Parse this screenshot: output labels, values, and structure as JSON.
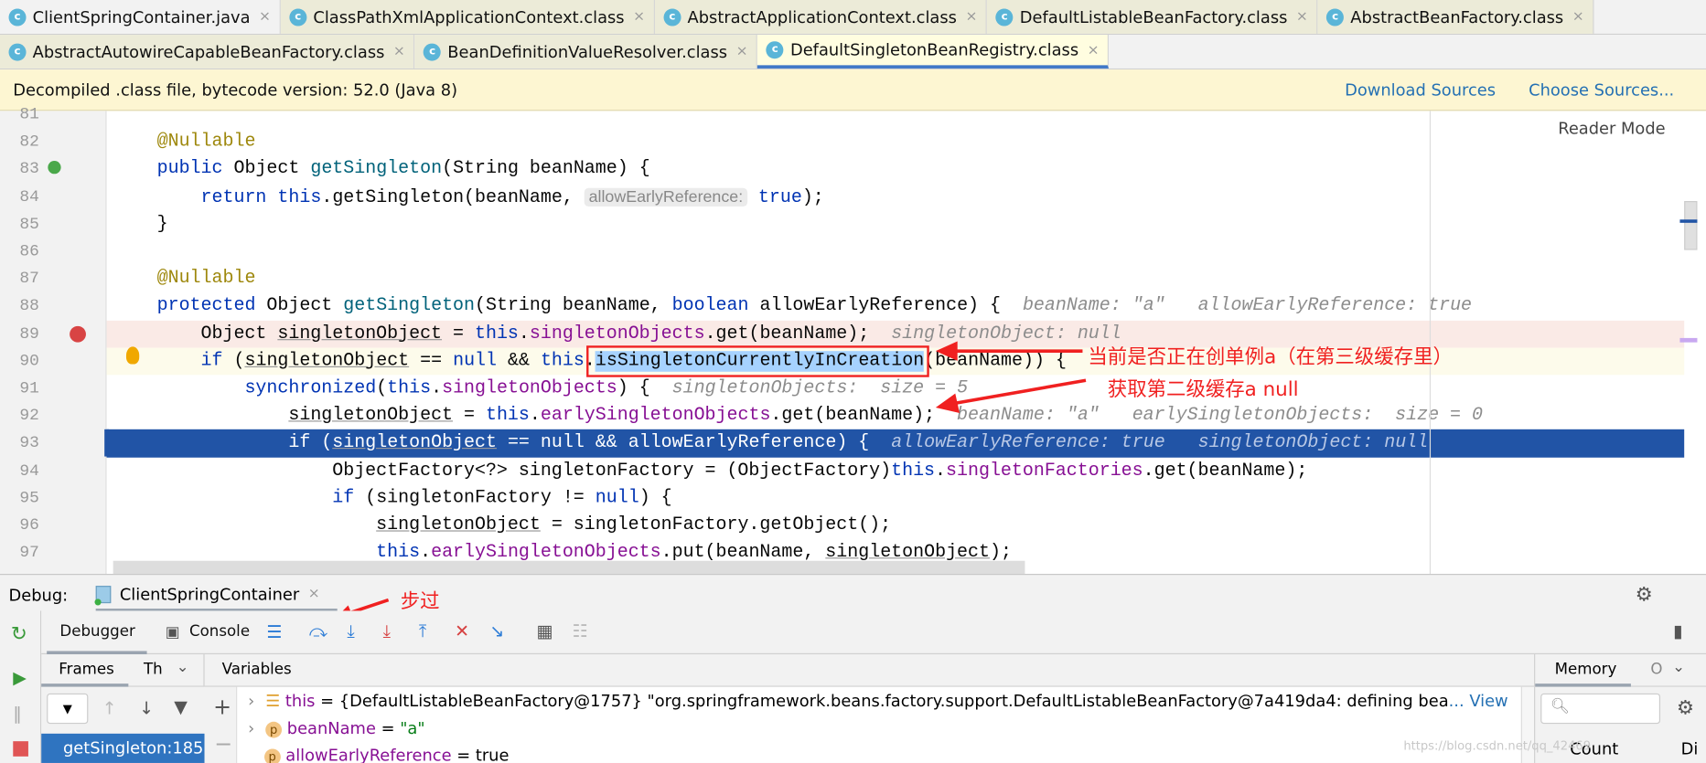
{
  "tabs_row1": [
    {
      "label": "ClientSpringContainer.java",
      "icon": "java-class-icon"
    },
    {
      "label": "ClassPathXmlApplicationContext.class",
      "icon": "class-icon"
    },
    {
      "label": "AbstractApplicationContext.class",
      "icon": "class-icon"
    },
    {
      "label": "DefaultListableBeanFactory.class",
      "icon": "class-icon"
    },
    {
      "label": "AbstractBeanFactory.class",
      "icon": "class-icon"
    }
  ],
  "tabs_row2": [
    {
      "label": "AbstractAutowireCapableBeanFactory.class",
      "icon": "class-icon"
    },
    {
      "label": "BeanDefinitionValueResolver.class",
      "icon": "class-icon"
    },
    {
      "label": "DefaultSingletonBeanRegistry.class",
      "icon": "class-icon",
      "active": true
    }
  ],
  "close_glyph": "×",
  "notice": {
    "text": "Decompiled .class file, bytecode version: 52.0 (Java 8)",
    "download": "Download Sources",
    "choose": "Choose Sources..."
  },
  "reader_mode": "Reader Mode",
  "code": [
    {
      "n": "81",
      "t": []
    },
    {
      "n": "82",
      "t": [
        [
          "    ",
          ""
        ],
        [
          "@Nullable",
          "an"
        ]
      ]
    },
    {
      "n": "83",
      "t": [
        [
          "    ",
          ""
        ],
        [
          "public",
          "kw"
        ],
        [
          " Object ",
          ""
        ],
        [
          "getSingleton",
          "mt"
        ],
        [
          "(String beanName) {",
          ""
        ]
      ]
    },
    {
      "n": "84",
      "t": [
        [
          "        ",
          ""
        ],
        [
          "return",
          "kw"
        ],
        [
          " ",
          ""
        ],
        [
          "this",
          "kw"
        ],
        [
          ".getSingleton(beanName, ",
          ""
        ],
        [
          "allowEarlyReference:",
          "inlay"
        ],
        [
          " ",
          ""
        ],
        [
          "true",
          "kw"
        ],
        [
          ");",
          ""
        ]
      ]
    },
    {
      "n": "85",
      "t": [
        [
          "    }",
          ""
        ]
      ]
    },
    {
      "n": "86",
      "t": []
    },
    {
      "n": "87",
      "t": [
        [
          "    ",
          ""
        ],
        [
          "@Nullable",
          "an"
        ]
      ]
    },
    {
      "n": "88",
      "t": [
        [
          "    ",
          ""
        ],
        [
          "protected",
          "kw"
        ],
        [
          " Object ",
          ""
        ],
        [
          "getSingleton",
          "mt"
        ],
        [
          "(String beanName, ",
          ""
        ],
        [
          "boolean",
          "kw"
        ],
        [
          " allowEarlyReference) {  ",
          ""
        ],
        [
          "beanName: \"a\"   allowEarlyReference: true",
          "hint"
        ]
      ]
    },
    {
      "n": "89",
      "bg": "#faeae6",
      "t": [
        [
          "        Object ",
          ""
        ],
        [
          "singletonObject",
          "ul"
        ],
        [
          " = ",
          ""
        ],
        [
          "this",
          "kw"
        ],
        [
          ".",
          ""
        ],
        [
          "singletonObjects",
          "fd"
        ],
        [
          ".get(beanName);  ",
          ""
        ],
        [
          "singletonObject: null",
          "hint"
        ]
      ]
    },
    {
      "n": "90",
      "bg": "#fdfbeb",
      "t": [
        [
          "        ",
          ""
        ],
        [
          "if",
          "kw"
        ],
        [
          " (",
          ""
        ],
        [
          "singletonObject",
          "ul"
        ],
        [
          " == ",
          ""
        ],
        [
          "null",
          "kw"
        ],
        [
          " && ",
          ""
        ],
        [
          "this",
          "kw"
        ],
        [
          ".",
          ""
        ],
        [
          "isSingletonCurrentlyInCreation",
          "sel"
        ],
        [
          "(beanName)) {",
          ""
        ]
      ]
    },
    {
      "n": "91",
      "t": [
        [
          "            ",
          ""
        ],
        [
          "synchronized",
          "kw"
        ],
        [
          "(",
          ""
        ],
        [
          "this",
          "kw"
        ],
        [
          ".",
          ""
        ],
        [
          "singletonObjects",
          "fd"
        ],
        [
          ") {  ",
          ""
        ],
        [
          "singletonObjects:  size = 5",
          "hint"
        ]
      ]
    },
    {
      "n": "92",
      "t": [
        [
          "                ",
          ""
        ],
        [
          "singletonObject",
          "ul"
        ],
        [
          " = ",
          ""
        ],
        [
          "this",
          "kw"
        ],
        [
          ".",
          ""
        ],
        [
          "earlySingletonObjects",
          "fd"
        ],
        [
          ".get(beanName);  ",
          ""
        ],
        [
          "beanName: \"a\"   earlySingletonObjects:  size = 0",
          "hint"
        ]
      ]
    },
    {
      "n": "93",
      "exec": true,
      "t": [
        [
          "                ",
          ""
        ],
        [
          "if",
          "kw"
        ],
        [
          " (",
          ""
        ],
        [
          "singletonObject",
          "ul"
        ],
        [
          " == ",
          ""
        ],
        [
          "null",
          "kw"
        ],
        [
          " && allowEarlyReference) {  ",
          ""
        ],
        [
          "allowEarlyReference: true   singletonObject: null",
          "hint"
        ]
      ]
    },
    {
      "n": "94",
      "t": [
        [
          "                    ObjectFactory<?> singletonFactory = (ObjectFactory)",
          ""
        ],
        [
          "this",
          "kw"
        ],
        [
          ".",
          ""
        ],
        [
          "singletonFactories",
          "fd"
        ],
        [
          ".get(beanName);",
          ""
        ]
      ]
    },
    {
      "n": "95",
      "t": [
        [
          "                    ",
          ""
        ],
        [
          "if",
          "kw"
        ],
        [
          " (singletonFactory != ",
          ""
        ],
        [
          "null",
          "kw"
        ],
        [
          ") {",
          ""
        ]
      ]
    },
    {
      "n": "96",
      "t": [
        [
          "                        ",
          ""
        ],
        [
          "singletonObject",
          "ul"
        ],
        [
          " = singletonFactory.getObject();",
          ""
        ]
      ]
    },
    {
      "n": "97",
      "t": [
        [
          "                        ",
          ""
        ],
        [
          "this",
          "kw"
        ],
        [
          ".",
          ""
        ],
        [
          "earlySingletonObjects",
          "fd"
        ],
        [
          ".put(beanName, ",
          ""
        ],
        [
          "singletonObject",
          "ul"
        ],
        [
          ");",
          ""
        ]
      ]
    }
  ],
  "annotations": {
    "a1": "当前是否正在创单例a（在第三级缓存里）",
    "a2": "获取第二级缓存a null",
    "a3": "步过"
  },
  "debug": {
    "label": "Debug:",
    "session": "ClientSpringContainer",
    "tabs": {
      "debugger": "Debugger",
      "console": "Console"
    },
    "frames_tab": "Frames",
    "threads_tab": "Th",
    "variables_tab": "Variables",
    "memory_tab": "Memory",
    "memory_more": "O",
    "frame": "getSingleton:185",
    "count_col": "Count",
    "diff_col": "Di",
    "vars": [
      {
        "icon": "field-list-icon",
        "name": "this",
        "value": " = {DefaultListableBeanFactory@1757} \"org.springframework.beans.factory.support.DefaultListableBeanFactory@7a419da4: defining bea",
        "more": "... View"
      },
      {
        "icon": "parameter-icon",
        "name": "beanName",
        "value": " = ",
        "str": "\"a\""
      },
      {
        "icon": "parameter-icon",
        "name": "allowEarlyReference",
        "value": " = true"
      }
    ]
  },
  "watermark": "https://blog.csdn.net/qq_42469"
}
